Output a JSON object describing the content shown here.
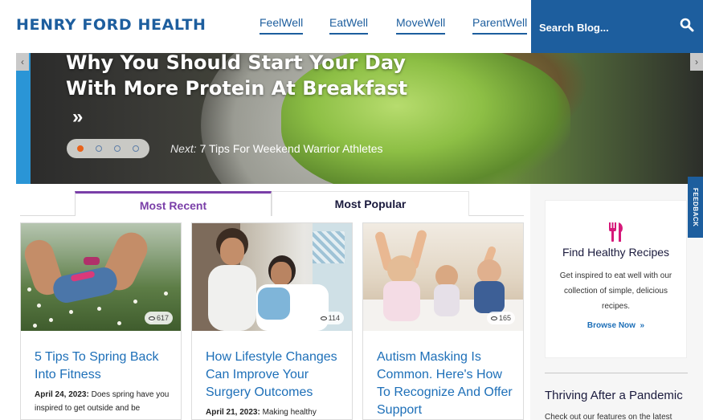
{
  "header": {
    "logo_text": "HENRY FORD HEALTH",
    "nav": [
      {
        "label": "FeelWell"
      },
      {
        "label": "EatWell"
      },
      {
        "label": "MoveWell"
      },
      {
        "label": "ParentWell"
      }
    ],
    "search_placeholder": "Search Blog...",
    "search_icon": "search-icon"
  },
  "hero": {
    "title": "Why You Should Start Your Day With More Protein At Breakfast",
    "arrow": "»",
    "slides_total": 4,
    "active_slide": 1,
    "next_label": "Next:",
    "next_title": "7 Tips For Weekend Warrior Athletes",
    "dot_active_color": "#e8621a"
  },
  "tabs": {
    "recent": "Most Recent",
    "popular": "Most Popular",
    "active": "recent"
  },
  "cards": [
    {
      "views": "617",
      "title": "5 Tips To Spring Back Into Fitness",
      "date": "April 24, 2023:",
      "excerpt": "Does spring have you inspired to get outside and be"
    },
    {
      "views": "114",
      "title": "How Lifestyle Changes Can Improve Your Surgery Outcomes",
      "date": "April 21, 2023:",
      "excerpt": "Making healthy"
    },
    {
      "views": "165",
      "title": "Autism Masking Is Common. Here's How To Recognize And Offer Support",
      "date": "",
      "excerpt": ""
    }
  ],
  "sidebar": {
    "icon": "fork-knife-icon",
    "title": "Find Healthy Recipes",
    "text": "Get inspired to eat well with our collection of simple, delicious recipes.",
    "link": "Browse Now",
    "link_arrow": "»",
    "heading": "Thriving After a Pandemic",
    "sub": "Check out our features on the latest"
  },
  "feedback": "FEEDBACK",
  "colors": {
    "brand_blue": "#1d5e9e",
    "link_blue": "#1d6fb8",
    "accent_purple": "#7a3fa8",
    "accent_orange": "#e8621a",
    "recipe_pink": "#d6197a"
  }
}
